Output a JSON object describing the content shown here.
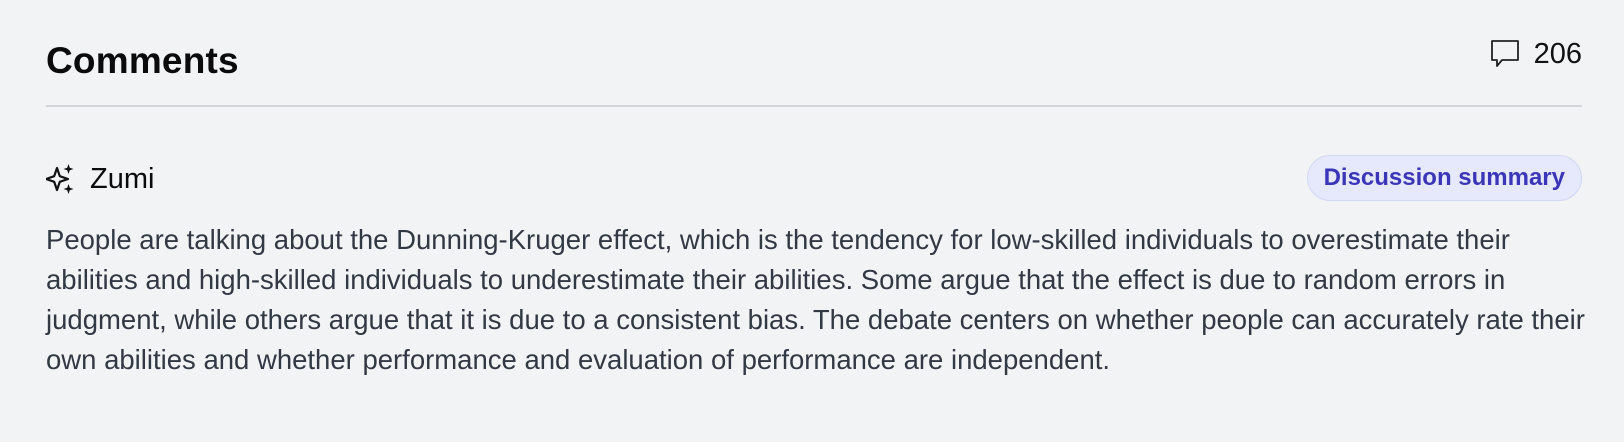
{
  "comments": {
    "title": "Comments",
    "count": "206",
    "count_icon": "speech-bubble-icon"
  },
  "summary": {
    "author_icon": "sparkle-icon",
    "author": "Zumi",
    "badge_label": "Discussion summary",
    "text": "People are talking about the Dunning-Kruger effect, which is the tendency for low-skilled individuals to overestimate their abilities and high-skilled individuals to underestimate their abilities. Some argue that the effect is due to random errors in judgment, while others argue that it is due to a consistent bias. The debate centers on whether people can accurately rate their own abilities and whether performance and evaluation of performance are independent.",
    "colors": {
      "badge_bg": "#e6e9fb",
      "badge_text": "#3b35b8",
      "body_text": "#323844"
    }
  }
}
